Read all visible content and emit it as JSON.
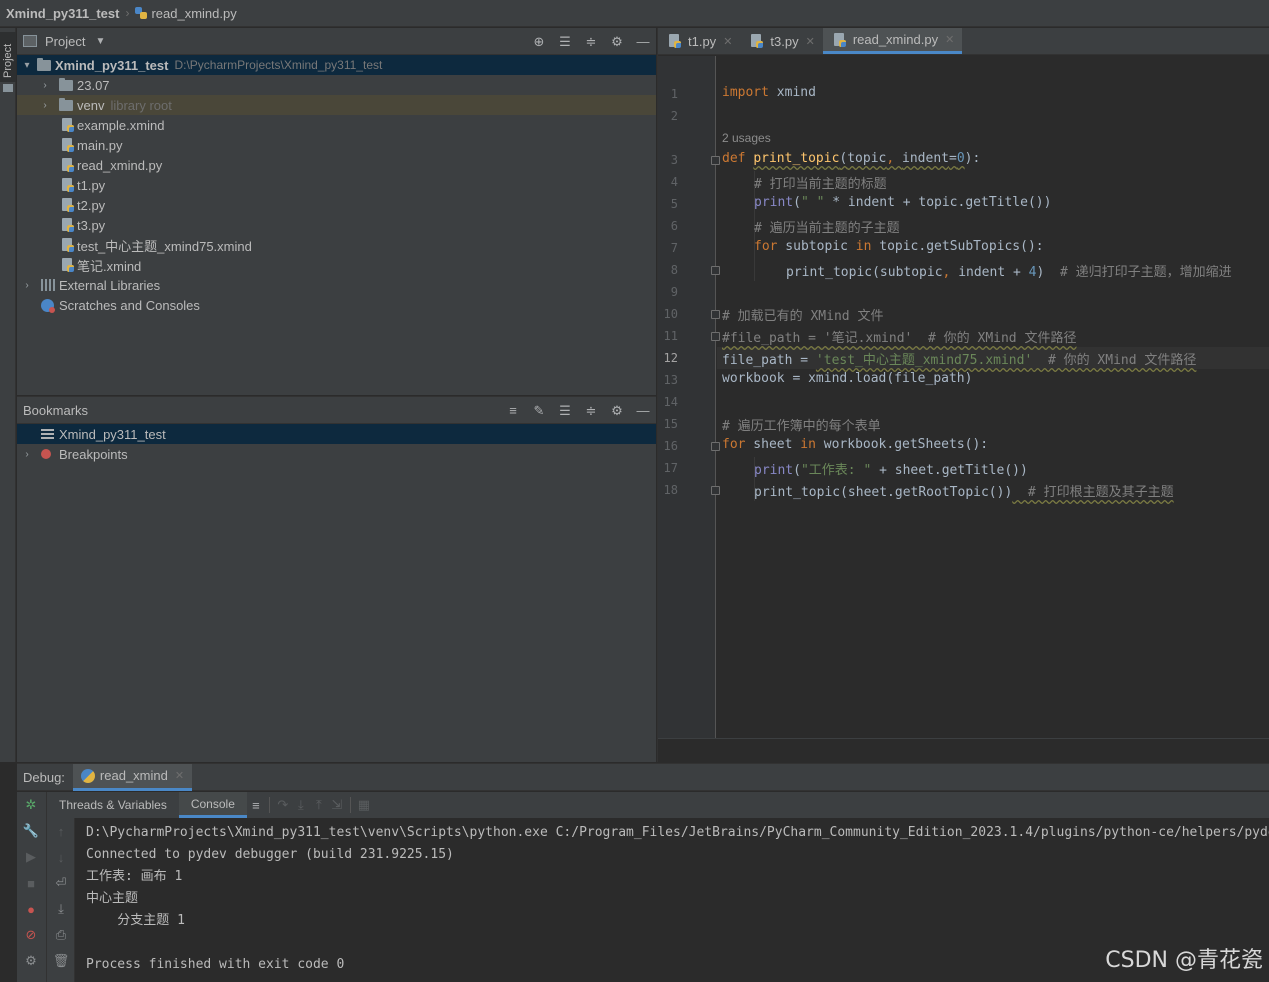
{
  "navbar": {
    "project": "Xmind_py311_test",
    "file": "read_xmind.py"
  },
  "left_strip": {
    "project_tab": "Project"
  },
  "project_panel": {
    "title": "Project",
    "root": {
      "name": "Xmind_py311_test",
      "path": "D:\\PycharmProjects\\Xmind_py311_test"
    },
    "folders": [
      {
        "name": "23.07",
        "hint": ""
      },
      {
        "name": "venv",
        "hint": "library root"
      }
    ],
    "files": [
      "example.xmind",
      "main.py",
      "read_xmind.py",
      "t1.py",
      "t2.py",
      "t3.py",
      "test_中心主题_xmind75.xmind",
      "笔记.xmind"
    ],
    "external_libraries": "External Libraries",
    "scratches": "Scratches and Consoles"
  },
  "bookmarks_panel": {
    "title": "Bookmarks",
    "items": [
      {
        "label": "Xmind_py311_test"
      },
      {
        "label": "Breakpoints"
      }
    ]
  },
  "editor": {
    "tabs": [
      {
        "label": "t1.py",
        "active": false
      },
      {
        "label": "t3.py",
        "active": false
      },
      {
        "label": "read_xmind.py",
        "active": true
      }
    ],
    "usages_hint": "2 usages",
    "line_numbers": [
      "1",
      "2",
      "3",
      "4",
      "5",
      "6",
      "7",
      "8",
      "9",
      "10",
      "11",
      "12",
      "13",
      "14",
      "15",
      "16",
      "17",
      "18"
    ],
    "current_line": "12",
    "code": {
      "l1_kw": "import",
      "l1_rest": " xmind",
      "l3_kw": "def",
      "l3_fn": "print_topic",
      "l3_open": "(",
      "l3_p1": "topic",
      "l3_sep": ", ",
      "l3_p2": "indent",
      "l3_eq": "=",
      "l3_num": "0",
      "l3_close": "):",
      "l4": "# 打印当前主题的标题",
      "l5_bi": "print",
      "l5_open": "(",
      "l5_str": "\" \"",
      "l5_rest": " * indent + topic.getTitle())",
      "l6": "# 遍历当前主题的子主题",
      "l7_kw1": "for",
      "l7_mid": " subtopic ",
      "l7_kw2": "in",
      "l7_rest": " topic.getSubTopics():",
      "l8_code": "print_topic(subtopic",
      "l8_comma": ",",
      "l8_mid": " indent + ",
      "l8_num": "4",
      "l8_close": ")",
      "l8_cmt": "  # 递归打印子主题，增加缩进",
      "l10": "# 加载已有的 XMind 文件",
      "l11": "#file_path = '笔记.xmind'  # 你的 XMind 文件路径",
      "l12_code": "file_path = ",
      "l12_str": "'test_中心主题_xmind75.xmind'",
      "l12_cmt": "  # 你的 XMind 文件路径",
      "l13": "workbook = xmind.load(file_path)",
      "l15": "# 遍历工作簿中的每个表单",
      "l16_kw1": "for",
      "l16_mid": " sheet ",
      "l16_kw2": "in",
      "l16_rest": " workbook.getSheets():",
      "l17_bi": "print",
      "l17_open": "(",
      "l17_str": "\"工作表: \"",
      "l17_rest": " + sheet.getTitle())",
      "l18_code": "print_topic(sheet.getRootTopic())",
      "l18_cmt": "  # 打印根主题及其子主题"
    }
  },
  "debug": {
    "label": "Debug:",
    "run_tab": "read_xmind",
    "subtabs": [
      "Threads & Variables",
      "Console"
    ],
    "active_subtab": "Console",
    "console_lines": [
      "D:\\PycharmProjects\\Xmind_py311_test\\venv\\Scripts\\python.exe C:/Program_Files/JetBrains/PyCharm_Community_Edition_2023.1.4/plugins/python-ce/helpers/pyde",
      "Connected to pydev debugger (build 231.9225.15)",
      "工作表: 画布 1",
      "中心主题",
      "    分支主题 1",
      "",
      "Process finished with exit code 0"
    ]
  },
  "watermark": "CSDN @青花瓷",
  "colors": {
    "accent": "#4a88c7",
    "selection": "#0d293e",
    "keyword": "#cc7832",
    "function": "#ffc66d",
    "string": "#6a8759",
    "comment": "#808080"
  }
}
